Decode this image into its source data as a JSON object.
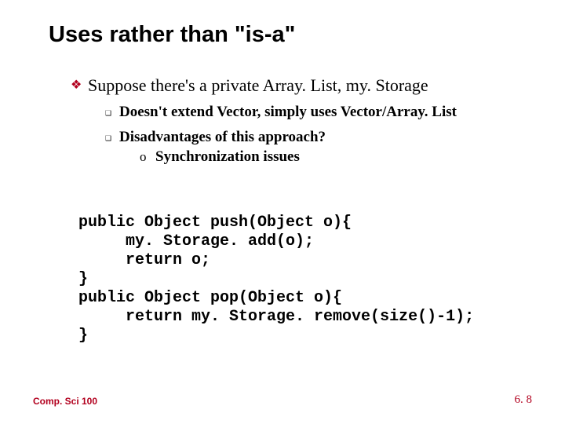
{
  "title": "Uses rather than \"is-a\"",
  "bullets": {
    "lvl1": "Suppose there's a private Array. List, my. Storage",
    "lvl2a": "Doesn't extend Vector, simply uses Vector/Array. List",
    "lvl2b": "Disadvantages of this approach?",
    "lvl3": "Synchronization issues"
  },
  "code": "public Object push(Object o){\n     my. Storage. add(o);\n     return o;\n}\npublic Object pop(Object o){\n     return my. Storage. remove(size()-1);\n}",
  "footer": {
    "left": "Comp. Sci 100",
    "right": "6. 8"
  },
  "markers": {
    "diamond": "❖",
    "square": "❑",
    "circle": "o"
  }
}
